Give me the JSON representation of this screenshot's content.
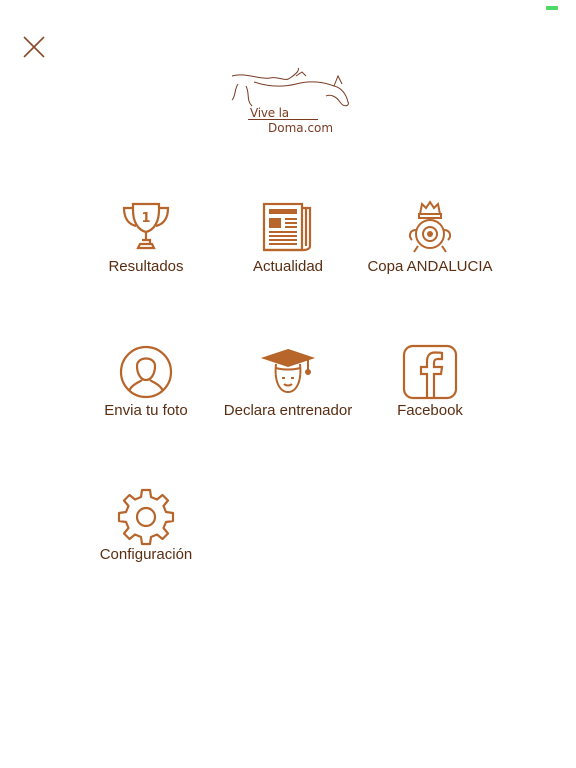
{
  "status_bar": {
    "battery_color": "#4cd964"
  },
  "close_button": {
    "icon": "close-icon"
  },
  "logo": {
    "line1": "Vive la",
    "line2": "Doma.com"
  },
  "colors": {
    "icon": "#b7652a",
    "text": "#5a2d12",
    "logo": "#7a3b22"
  },
  "menu": {
    "items": [
      {
        "label": "Resultados",
        "icon": "trophy-icon"
      },
      {
        "label": "Actualidad",
        "icon": "newspaper-icon"
      },
      {
        "label": "Copa ANDALUCIA",
        "icon": "crest-icon"
      },
      {
        "label": "Envia tu foto",
        "icon": "user-photo-icon"
      },
      {
        "label": "Declara entrenador",
        "icon": "graduate-icon"
      },
      {
        "label": "Facebook",
        "icon": "facebook-icon"
      },
      {
        "label": "Configuración",
        "icon": "gear-icon"
      }
    ]
  }
}
